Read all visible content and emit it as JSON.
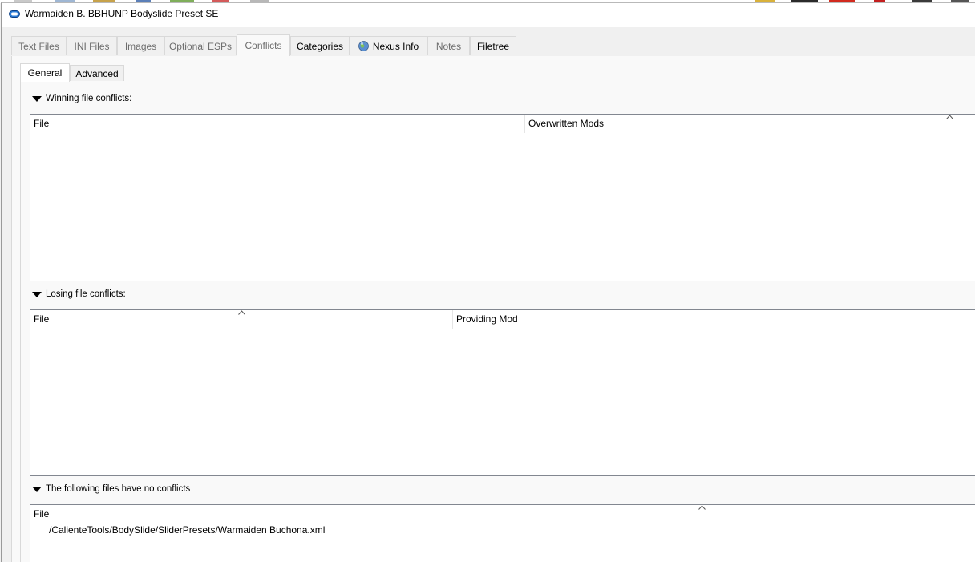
{
  "window": {
    "title": "Warmaiden B. BBHUNP Bodyslide Preset SE"
  },
  "tabs": [
    {
      "label": "Text Files",
      "state": "disabled"
    },
    {
      "label": "INI Files",
      "state": "disabled"
    },
    {
      "label": "Images",
      "state": "disabled"
    },
    {
      "label": "Optional ESPs",
      "state": "disabled"
    },
    {
      "label": "Conflicts",
      "state": "active"
    },
    {
      "label": "Categories",
      "state": "enabled"
    },
    {
      "label": "Nexus Info",
      "state": "enabled",
      "icon": "globe-icon"
    },
    {
      "label": "Notes",
      "state": "disabled"
    },
    {
      "label": "Filetree",
      "state": "enabled"
    }
  ],
  "subtabs": [
    {
      "label": "General",
      "state": "active"
    },
    {
      "label": "Advanced",
      "state": "enabled"
    }
  ],
  "winning": {
    "heading": "Winning file conflicts:",
    "columns": [
      "File",
      "Overwritten Mods"
    ],
    "rows": []
  },
  "losing": {
    "heading": "Losing file conflicts:",
    "columns": [
      "File",
      "Providing Mod"
    ],
    "rows": []
  },
  "no_conflicts": {
    "heading": "The following files have no conflicts",
    "columns": [
      "File"
    ],
    "rows": [
      "/CalienteTools/BodySlide/SliderPresets/Warmaiden Buchona.xml"
    ]
  },
  "colors": {
    "window_bg": "#f0f0f0",
    "panel_bg": "#f9f9f9",
    "list_border": "#828790",
    "disabled_text": "#6d6d6d"
  }
}
